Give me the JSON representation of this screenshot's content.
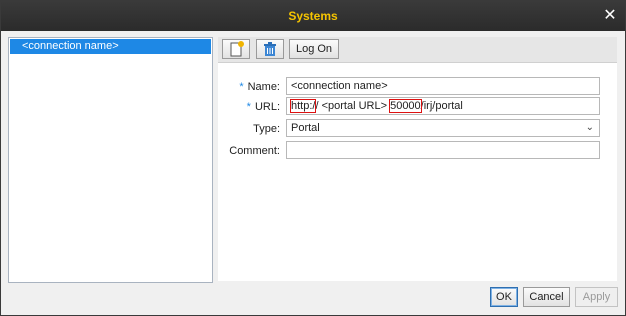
{
  "window": {
    "title": "Systems",
    "close_label": "✕"
  },
  "list": {
    "items": [
      {
        "label": "<connection name>"
      }
    ]
  },
  "toolbar": {
    "logon_label": "Log On"
  },
  "form": {
    "name": {
      "label": "Name:",
      "required_marker": "*",
      "value": "<connection name>"
    },
    "url": {
      "label": "URL:",
      "required_marker": "*",
      "parts": [
        "http:/",
        "/",
        " <portal URL> ",
        "50000",
        "/irj/portal"
      ]
    },
    "type": {
      "label": "Type:",
      "value": "Portal"
    },
    "comment": {
      "label": "Comment:",
      "value": ""
    }
  },
  "footer": {
    "ok_label": "OK",
    "cancel_label": "Cancel",
    "apply_label": "Apply"
  },
  "icons": {
    "new": "new-document-icon",
    "delete": "trash-icon",
    "close": "close-icon",
    "dropdown": "chevron-down-icon"
  },
  "colors": {
    "title_text": "#f5c400",
    "selection": "#1e88e5",
    "required": "#1e88e5",
    "highlight_box": "#d11111"
  }
}
